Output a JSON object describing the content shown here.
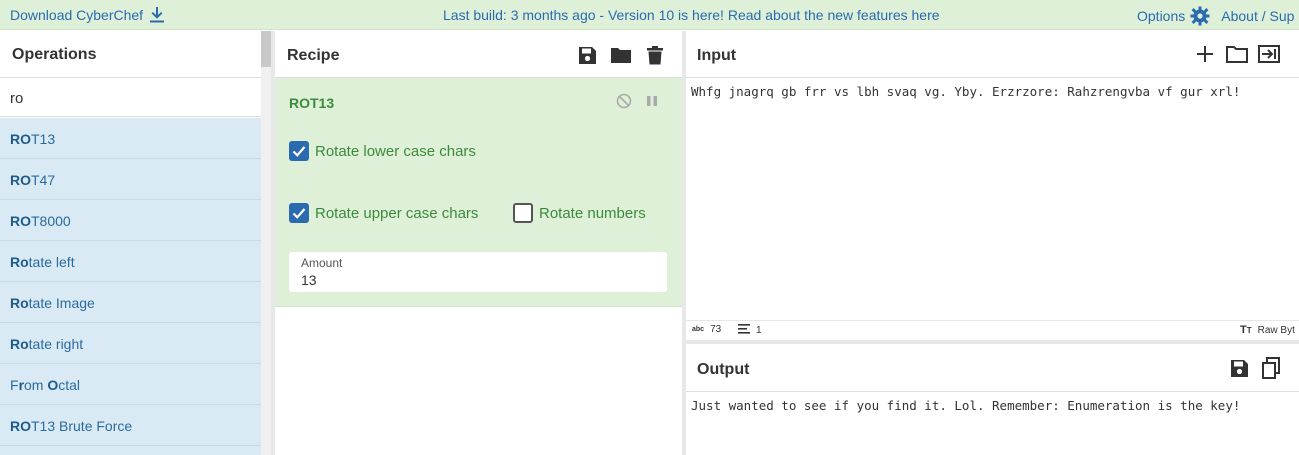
{
  "banner": {
    "download_label": "Download CyberChef",
    "build_text": "Last build: 3 months ago - Version 10 is here! Read about the new features ",
    "build_link": "here",
    "options_label": "Options",
    "about_label": "About / Sup"
  },
  "operations": {
    "title": "Operations",
    "search_value": "ro",
    "items": [
      {
        "match": "RO",
        "rest": "T13"
      },
      {
        "match": "RO",
        "rest": "T47"
      },
      {
        "match": "RO",
        "rest": "T8000"
      },
      {
        "match": "Ro",
        "rest": "tate left"
      },
      {
        "match": "Ro",
        "rest": "tate Image"
      },
      {
        "match": "Ro",
        "rest": "tate right"
      },
      {
        "pre": "F",
        "match": "r",
        "mid": "om ",
        "match2": "O",
        "rest": "ctal"
      },
      {
        "match": "RO",
        "rest": "T13 Brute Force"
      }
    ]
  },
  "recipe": {
    "title": "Recipe",
    "operation": {
      "name": "ROT13",
      "rotate_lower_label": "Rotate lower case chars",
      "rotate_lower_checked": true,
      "rotate_upper_label": "Rotate upper case chars",
      "rotate_upper_checked": true,
      "rotate_numbers_label": "Rotate numbers",
      "rotate_numbers_checked": false,
      "amount_label": "Amount",
      "amount_value": "13"
    }
  },
  "input": {
    "title": "Input",
    "text": "Whfg jnagrq gb frr vs lbh svaq vg. Yby. Erzrzore: Rahzrengvba vf gur xrl!",
    "length": "73",
    "lines": "1",
    "encoding": "Raw Byt"
  },
  "output": {
    "title": "Output",
    "text": "Just wanted to see if you find it. Lol. Remember: Enumeration is the key!"
  },
  "colors": {
    "banner_bg": "#dff0d8",
    "link": "#2a6bb0",
    "op_list_bg": "#d9eaf4",
    "recipe_op_bg": "#dff0d8",
    "recipe_green": "#3c8b3c"
  }
}
